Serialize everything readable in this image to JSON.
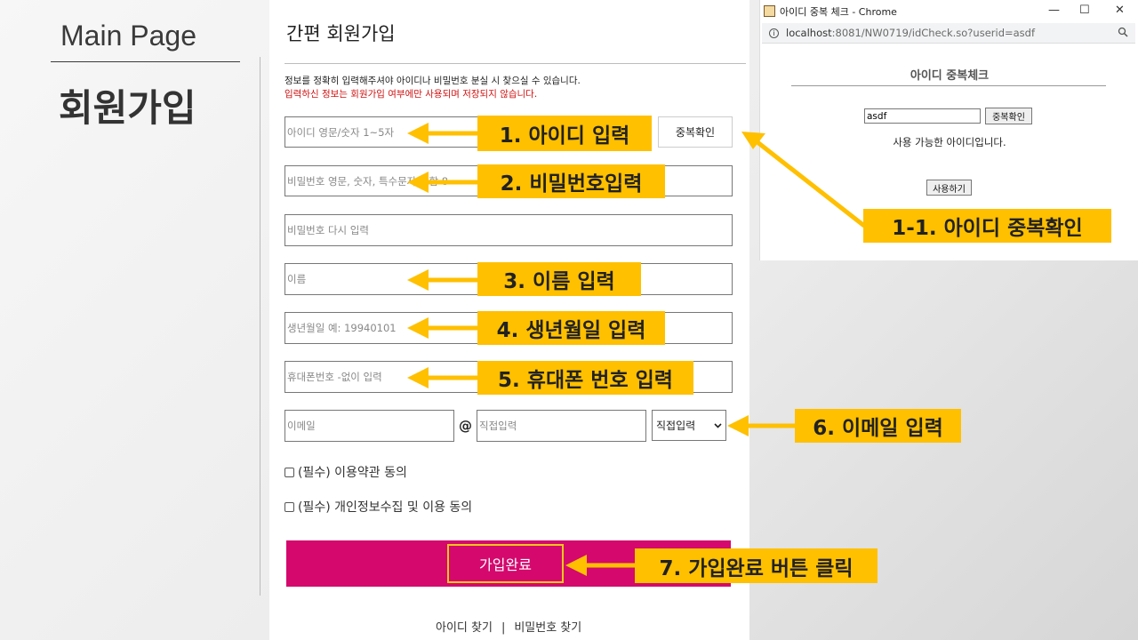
{
  "slide": {
    "title": "Main Page",
    "heading": "회원가입"
  },
  "form": {
    "title": "간편 회원가입",
    "notice_line1": "정보를 정확히 입력해주셔야 아이디나 비밀번호 분실 시 찾으실 수 있습니다.",
    "notice_line2": "입력하신 정보는 회원가입 여부에만 사용되며 저장되지 않습니다.",
    "id_placeholder": "아이디 영문/숫자 1~5자",
    "id_check_button": "중복확인",
    "password_placeholder": "비밀번호 영문, 숫자, 특수문자 조합 8",
    "password_confirm_placeholder": "비밀번호 다시 입력",
    "name_placeholder": "이름",
    "birth_placeholder": "생년월일 예: 19940101",
    "phone_placeholder": "휴대폰번호 -없이 입력",
    "email_placeholder": "이메일",
    "at_symbol": "@",
    "domain_placeholder": "직접입력",
    "domain_select_value": "직접입력",
    "agree_terms": "(필수) 이용약관 동의",
    "agree_privacy": "(필수) 개인정보수집 및 이용 동의",
    "submit_label": "가입완료",
    "find_id": "아이디 찾기",
    "separator": "|",
    "find_password": "비밀번호 찾기",
    "colors": {
      "submit_bar": "#d4086d",
      "notice_red": "#d01010"
    }
  },
  "callouts": {
    "c1": "1. 아이디 입력",
    "c1_1": "1-1. 아이디 중복확인",
    "c2": "2. 비밀번호입력",
    "c3": "3. 이름 입력",
    "c4": "4. 생년월일 입력",
    "c5": "5. 휴대폰 번호 입력",
    "c6": "6. 이메일 입력",
    "c7": "7. 가입완료 버튼 클릭",
    "color": "#ffc000"
  },
  "popup": {
    "window_title": "아이디 중복 체크 - Chrome",
    "url_host": "localhost",
    "url_rest": ":8081/NW0719/idCheck.so?userid=asdf",
    "heading": "아이디 중복체크",
    "input_value": "asdf",
    "check_button": "중복확인",
    "message": "사용 가능한 아이디입니다.",
    "use_button": "사용하기",
    "controls": {
      "minimize": "—",
      "maximize": "☐",
      "close": "✕"
    }
  }
}
